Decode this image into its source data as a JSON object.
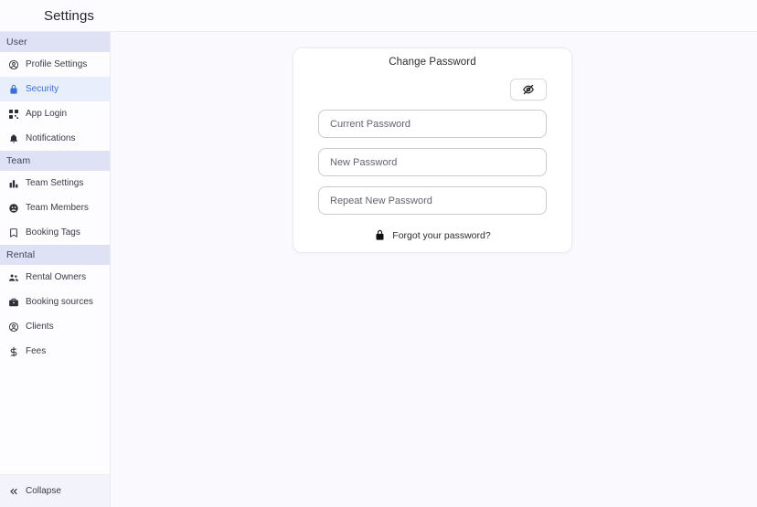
{
  "topbar": {
    "title": "Settings"
  },
  "sidebar": {
    "sections": [
      {
        "header": "User",
        "items": [
          {
            "label": "Profile Settings",
            "icon": "user-circle-icon",
            "active": false
          },
          {
            "label": "Security",
            "icon": "lock-icon",
            "active": true
          },
          {
            "label": "App Login",
            "icon": "qr-grid-icon",
            "active": false
          },
          {
            "label": "Notifications",
            "icon": "bell-icon",
            "active": false
          }
        ]
      },
      {
        "header": "Team",
        "items": [
          {
            "label": "Team Settings",
            "icon": "bar-chart-icon",
            "active": false
          },
          {
            "label": "Team Members",
            "icon": "users-circle-icon",
            "active": false
          },
          {
            "label": "Booking Tags",
            "icon": "bookmark-icon",
            "active": false
          }
        ]
      },
      {
        "header": "Rental",
        "items": [
          {
            "label": "Rental Owners",
            "icon": "people-group-icon",
            "active": false
          },
          {
            "label": "Booking sources",
            "icon": "briefcase-icon",
            "active": false
          },
          {
            "label": "Clients",
            "icon": "user-circle-icon",
            "active": false
          },
          {
            "label": "Fees",
            "icon": "dollar-sign-icon",
            "active": false
          }
        ]
      }
    ],
    "collapse": {
      "label": "Collapse",
      "icon": "chevrons-left-icon"
    }
  },
  "main": {
    "card": {
      "title": "Change Password",
      "reveal_button": {
        "icon": "eye-off-icon",
        "label": ""
      },
      "fields": [
        {
          "placeholder": "Current Password",
          "value": ""
        },
        {
          "placeholder": "New Password",
          "value": ""
        },
        {
          "placeholder": "Repeat New Password",
          "value": ""
        }
      ],
      "forgot": {
        "icon": "lock-closed-icon",
        "label": "Forgot your password?"
      }
    }
  },
  "colors": {
    "accent": "#3b6fd4",
    "section_header_bg": "#dfe2f5",
    "active_item_bg": "#e8eefb",
    "page_bg": "#faf9fd",
    "card_bg": "#ffffff"
  }
}
